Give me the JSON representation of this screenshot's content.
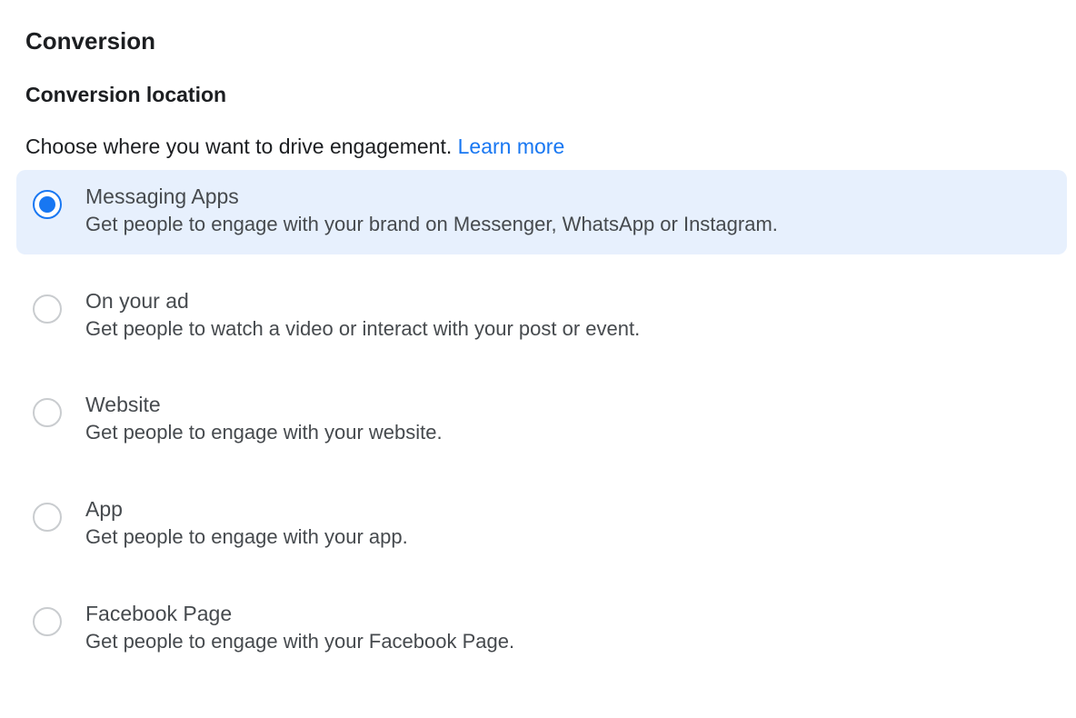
{
  "section": {
    "title": "Conversion",
    "subtitle": "Conversion location",
    "description": "Choose where you want to drive engagement. ",
    "learn_more": "Learn more",
    "options": [
      {
        "title": "Messaging Apps",
        "desc": "Get people to engage with your brand on Messenger, WhatsApp or Instagram.",
        "selected": true
      },
      {
        "title": "On your ad",
        "desc": "Get people to watch a video or interact with your post or event.",
        "selected": false
      },
      {
        "title": "Website",
        "desc": "Get people to engage with your website.",
        "selected": false
      },
      {
        "title": "App",
        "desc": "Get people to engage with your app.",
        "selected": false
      },
      {
        "title": "Facebook Page",
        "desc": "Get people to engage with your Facebook Page.",
        "selected": false
      }
    ]
  }
}
